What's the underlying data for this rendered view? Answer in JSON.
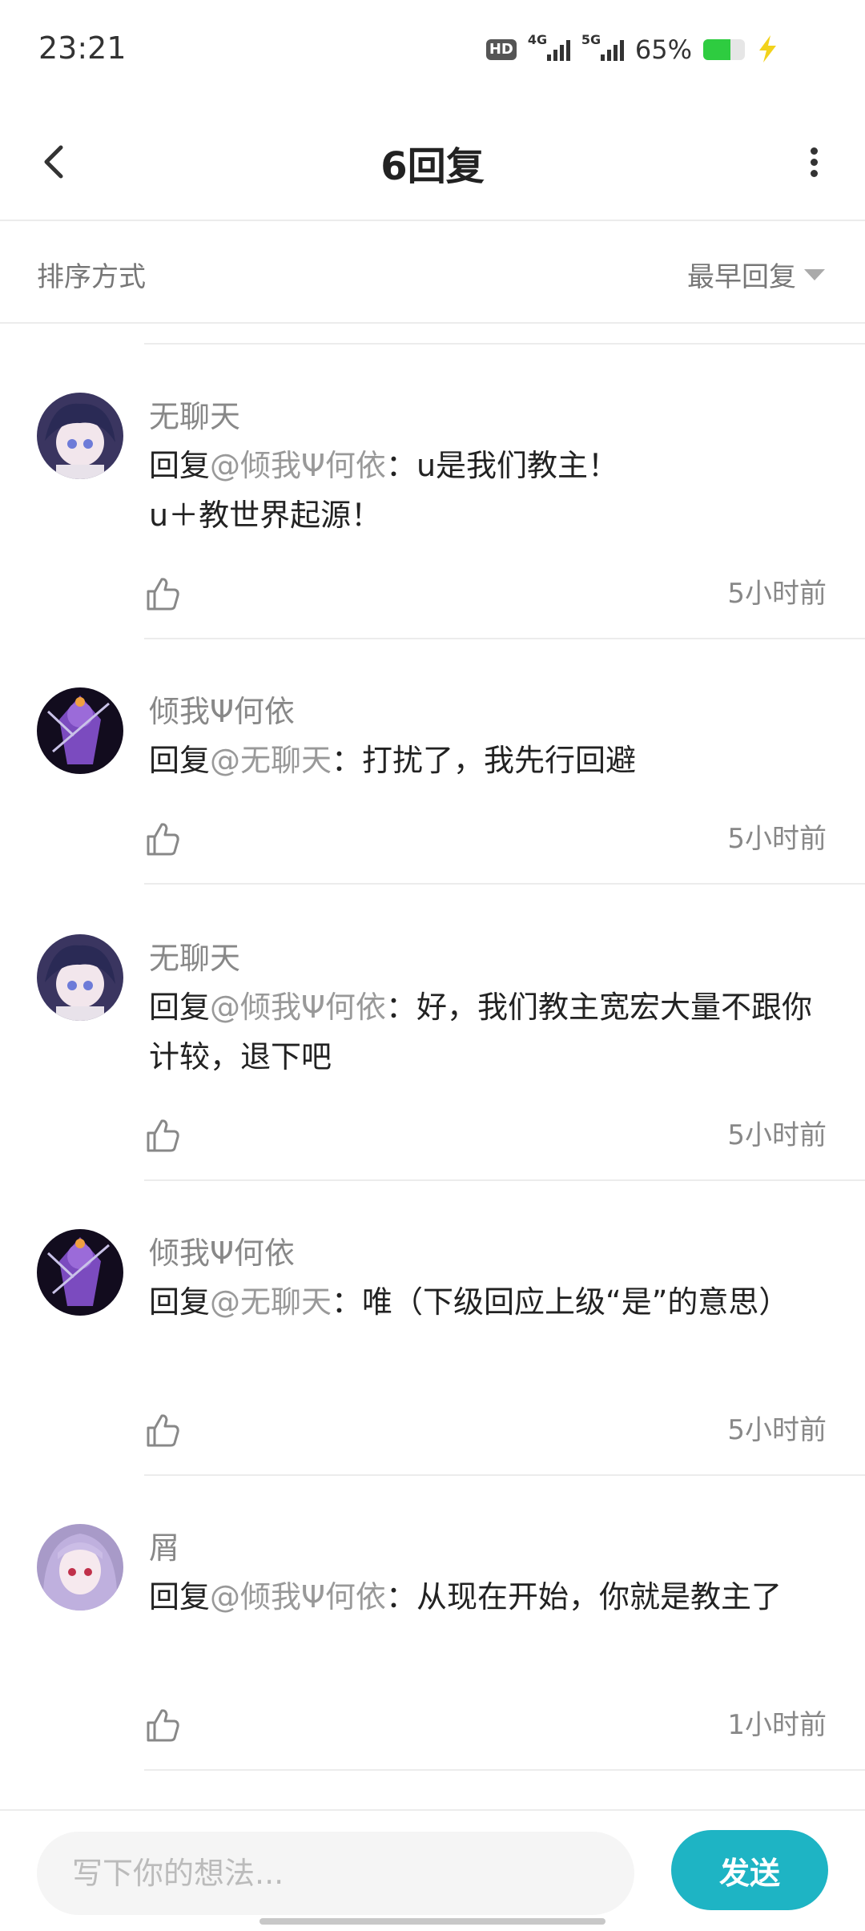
{
  "status_bar": {
    "time": "23:21",
    "hd_badge": "HD",
    "network_1": "4G",
    "network_2": "5G",
    "battery_percent_text": "65%",
    "battery_level": 0.65
  },
  "header": {
    "title": "6回复",
    "back_icon": "chevron-left-icon",
    "more_icon": "more-vertical-icon"
  },
  "sort": {
    "label": "排序方式",
    "selected": "最早回复"
  },
  "comments": [
    {
      "user": "无聊天",
      "reply_prefix": "回复",
      "mention": "@倾我Ψ何依",
      "text": "：u是我们教主！\nu＋教世界起源！",
      "time": "5小时前",
      "avatar": "avatar-dark-purple-hair"
    },
    {
      "user": "倾我Ψ何依",
      "reply_prefix": "回复",
      "mention": "@无聊天",
      "text": "：打扰了，我先行回避",
      "time": "5小时前",
      "avatar": "avatar-purple-character"
    },
    {
      "user": "无聊天",
      "reply_prefix": "回复",
      "mention": "@倾我Ψ何依",
      "text": "：好，我们教主宽宏大量不跟你计较，退下吧",
      "time": "5小时前",
      "avatar": "avatar-dark-purple-hair"
    },
    {
      "user": "倾我Ψ何依",
      "reply_prefix": "回复",
      "mention": "@无聊天",
      "text": "：唯（下级回应上级“是”的意思）",
      "time": "5小时前",
      "avatar": "avatar-purple-character"
    },
    {
      "user": "屑",
      "reply_prefix": "回复",
      "mention": "@倾我Ψ何依",
      "text": "：从现在开始，你就是教主了",
      "time": "1小时前",
      "avatar": "avatar-lilac-hair-girl"
    }
  ],
  "composer": {
    "placeholder": "写下你的想法...",
    "send_label": "发送"
  },
  "colors": {
    "accent": "#1eb4c4",
    "mention": "#999999",
    "battery_green": "#2ecc40"
  }
}
